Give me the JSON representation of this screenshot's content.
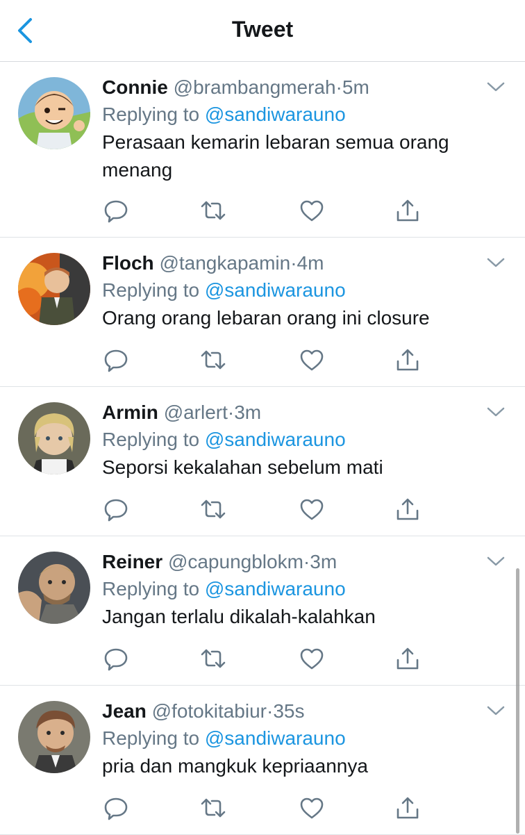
{
  "header": {
    "title": "Tweet"
  },
  "reply_prefix": "Replying to",
  "tweets": [
    {
      "name": "Connie",
      "handle": "@brambangmerah",
      "time": "5m",
      "replying_to": "@sandiwarauno",
      "text": "Perasaan kemarin lebaran semua orang menang"
    },
    {
      "name": "Floch",
      "handle": "@tangkapamin",
      "time": "4m",
      "replying_to": "@sandiwarauno",
      "text": "Orang orang lebaran orang ini closure"
    },
    {
      "name": "Armin",
      "handle": "@arlert",
      "time": "3m",
      "replying_to": "@sandiwarauno",
      "text": "Seporsi kekalahan sebelum mati"
    },
    {
      "name": "Reiner",
      "handle": "@capungblokm",
      "time": "3m",
      "replying_to": "@sandiwarauno",
      "text": "Jangan terlalu dikalah-kalahkan"
    },
    {
      "name": "Jean",
      "handle": "@fotokitabiur",
      "time": "35s",
      "replying_to": "@sandiwarauno",
      "text": "pria dan mangkuk kepriaannya"
    }
  ],
  "icons": [
    "back-chevron-icon",
    "chevron-down-icon",
    "reply-icon",
    "retweet-icon",
    "like-icon",
    "share-icon"
  ],
  "colors": {
    "accent": "#1b95e0",
    "muted": "#657786",
    "text": "#14171a",
    "divider": "#dfe3e6"
  }
}
